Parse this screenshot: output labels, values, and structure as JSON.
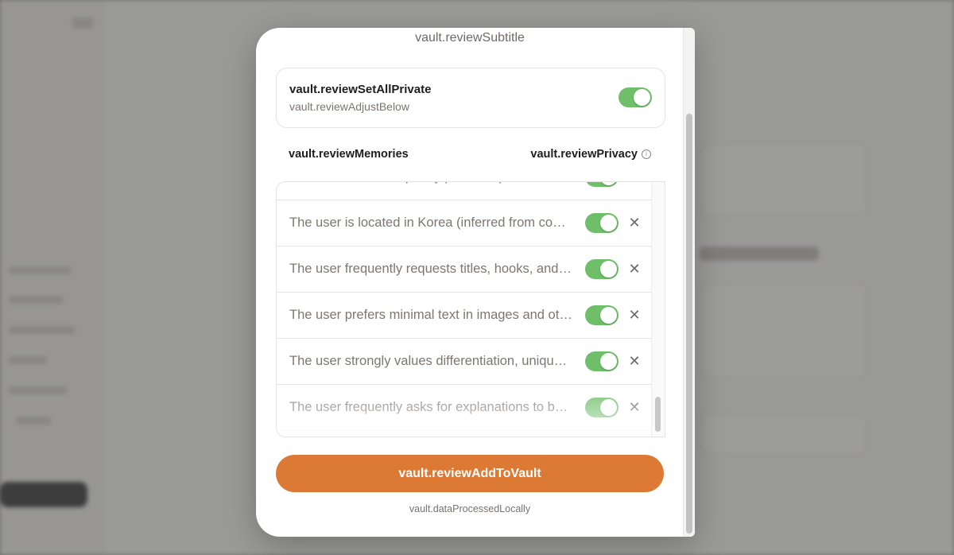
{
  "modal": {
    "subtitle": "vault.reviewSubtitle",
    "set_all": {
      "title": "vault.reviewSetAllPrivate",
      "subtitle": "vault.reviewAdjustBelow",
      "enabled": true
    },
    "columns": {
      "memories": "vault.reviewMemories",
      "privacy": "vault.reviewPrivacy"
    },
    "memories": [
      {
        "text": "The user has not explicitly provided personal information",
        "private": true
      },
      {
        "text": "The user is located in Korea (inferred from conversation context)",
        "private": true
      },
      {
        "text": "The user frequently requests titles, hooks, and short-form copy",
        "private": true
      },
      {
        "text": "The user prefers minimal text in images and other visuals",
        "private": true
      },
      {
        "text": "The user strongly values differentiation, uniqueness, and originality",
        "private": true
      },
      {
        "text": "The user frequently asks for explanations to be concise",
        "private": true
      }
    ],
    "add_button": "vault.reviewAddToVault",
    "footnote": "vault.dataProcessedLocally",
    "colors": {
      "accent": "#dc7a35",
      "toggle_on": "#6ebe6a"
    }
  }
}
